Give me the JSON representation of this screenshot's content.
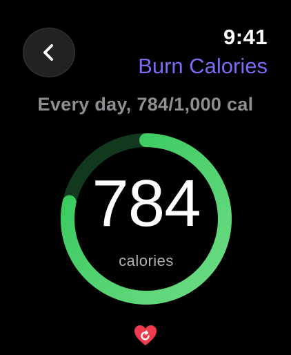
{
  "header": {
    "time": "9:41",
    "title": "Burn Calories",
    "back_icon": "chevron-left-icon"
  },
  "goal": {
    "subtitle": "Every day, 784/1,000 cal",
    "current": 784,
    "target": 1000,
    "progress": 0.784
  },
  "ring": {
    "value": "784",
    "unit": "calories"
  },
  "footer": {
    "icon": "heart-sync-icon"
  },
  "colors": {
    "background": "#000000",
    "accent_title": "#7b6cf6",
    "ring_start": "#6fdc86",
    "ring_end": "#30c758",
    "ring_track": "#12381e",
    "heart": "#ef3b4d"
  }
}
